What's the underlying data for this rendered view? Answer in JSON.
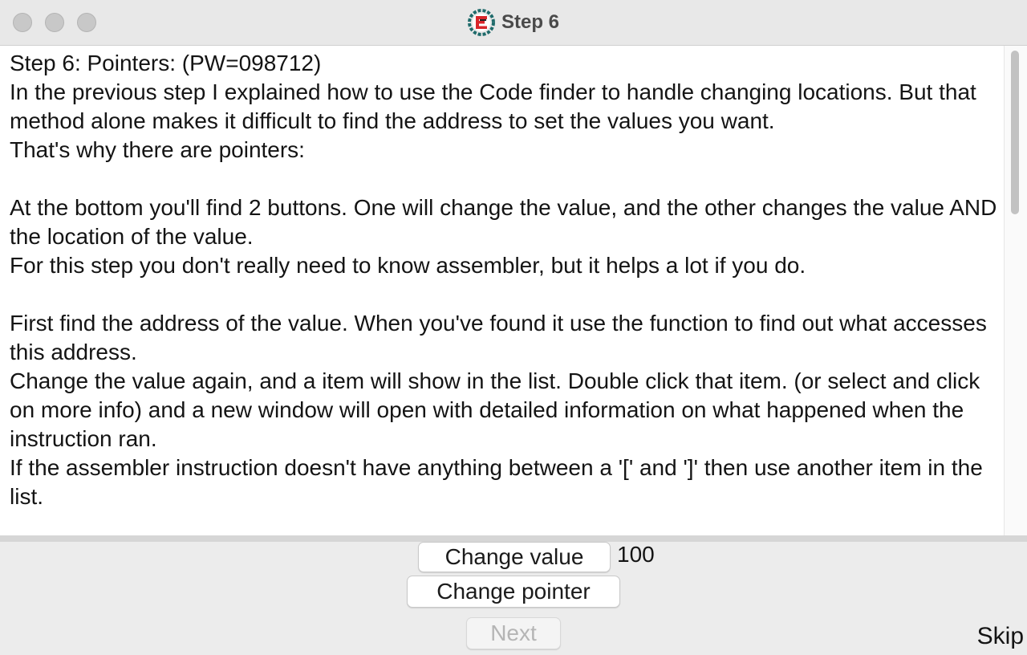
{
  "window": {
    "title": "Step 6"
  },
  "tutorial": {
    "text": "Step 6: Pointers: (PW=098712)\nIn the previous step I explained how to use the Code finder to handle changing locations. But that method alone makes it difficult to find the address to set the values you want.\nThat's why there are pointers:\n\nAt the bottom you'll find 2 buttons. One will change the value, and the other changes the value AND the location of the value.\nFor this step you don't really need to know assembler, but it helps a lot if you do.\n\nFirst find the address of the value. When you've found it use the function to find out what accesses this address.\nChange the value again, and a item will show in the list. Double click that item. (or select and click on more info) and a new window will open with detailed information on what happened when the instruction ran.\nIf the assembler instruction doesn't have anything between a '[' and ']' then use another item in the list."
  },
  "controls": {
    "change_value_label": "Change value",
    "current_value": "100",
    "change_pointer_label": "Change pointer",
    "next_label": "Next",
    "skip_label": "Skip"
  },
  "icons": {
    "app_icon": "cheat-engine-icon"
  },
  "colors": {
    "app_icon_red": "#d8262b",
    "app_icon_teal": "#1f6b6b"
  }
}
